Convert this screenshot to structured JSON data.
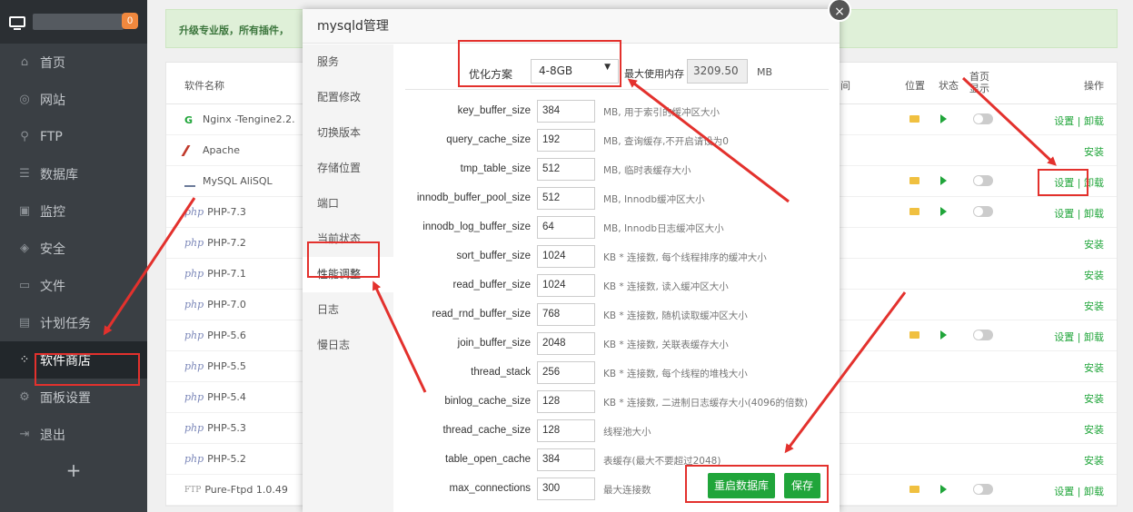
{
  "sidebar": {
    "badge": "0",
    "items": [
      {
        "icon": "home-icon",
        "glyph": "⌂",
        "label": "首页"
      },
      {
        "icon": "globe-icon",
        "glyph": "◎",
        "label": "网站"
      },
      {
        "icon": "ftp-icon",
        "glyph": "⚲",
        "label": "FTP"
      },
      {
        "icon": "database-icon",
        "glyph": "☰",
        "label": "数据库"
      },
      {
        "icon": "monitor-icon",
        "glyph": "▣",
        "label": "监控"
      },
      {
        "icon": "shield-icon",
        "glyph": "◈",
        "label": "安全"
      },
      {
        "icon": "folder-icon",
        "glyph": "▭",
        "label": "文件"
      },
      {
        "icon": "calendar-icon",
        "glyph": "▤",
        "label": "计划任务"
      },
      {
        "icon": "apps-icon",
        "glyph": "⁘",
        "label": "软件商店"
      },
      {
        "icon": "gear-icon",
        "glyph": "⚙",
        "label": "面板设置"
      },
      {
        "icon": "logout-icon",
        "glyph": "⇥",
        "label": "退出"
      }
    ],
    "add": "+"
  },
  "notice": "升级专业版，所有插件，",
  "table": {
    "headers": {
      "name": "软件名称",
      "col_time": "间",
      "location": "位置",
      "status": "状态",
      "home_show": "首页显示",
      "ops": "操作"
    },
    "rows": [
      {
        "name": "Nginx -Tengine2.2.",
        "prefix": "",
        "action": "设置 | 卸载",
        "installed": true
      },
      {
        "name": "Apache",
        "prefix": "",
        "action": "安装",
        "installed": false
      },
      {
        "name": "MySQL AliSQL",
        "prefix": "",
        "action": "设置 | 卸载",
        "installed": true
      },
      {
        "name": "PHP-7.3",
        "prefix": "php",
        "action": "设置 | 卸载",
        "installed": true
      },
      {
        "name": "PHP-7.2",
        "prefix": "php",
        "action": "安装",
        "installed": false
      },
      {
        "name": "PHP-7.1",
        "prefix": "php",
        "action": "安装",
        "installed": false
      },
      {
        "name": "PHP-7.0",
        "prefix": "php",
        "action": "安装",
        "installed": false
      },
      {
        "name": "PHP-5.6",
        "prefix": "php",
        "action": "设置 | 卸载",
        "installed": true
      },
      {
        "name": "PHP-5.5",
        "prefix": "php",
        "action": "安装",
        "installed": false
      },
      {
        "name": "PHP-5.4",
        "prefix": "php",
        "action": "安装",
        "installed": false
      },
      {
        "name": "PHP-5.3",
        "prefix": "php",
        "action": "安装",
        "installed": false
      },
      {
        "name": "PHP-5.2",
        "prefix": "php",
        "action": "安装",
        "installed": false
      },
      {
        "name": "Pure-Ftpd 1.0.49",
        "prefix": "FTP",
        "action": "设置 | 卸载",
        "installed": true
      }
    ]
  },
  "modal": {
    "title": "mysqld管理",
    "close": "×",
    "nav": [
      "服务",
      "配置修改",
      "切换版本",
      "存储位置",
      "端口",
      "当前状态",
      "性能调整",
      "日志",
      "慢日志"
    ],
    "opt_label": "优化方案",
    "opt_value": "4-8GB",
    "mem_label": "最大使用内存",
    "mem_value": "3209.50",
    "mem_unit": "MB",
    "params": [
      {
        "name": "key_buffer_size",
        "value": "384",
        "desc": "MB, 用于索引的缓冲区大小"
      },
      {
        "name": "query_cache_size",
        "value": "192",
        "desc": "MB, 查询缓存,不开启请设为0"
      },
      {
        "name": "tmp_table_size",
        "value": "512",
        "desc": "MB, 临时表缓存大小"
      },
      {
        "name": "innodb_buffer_pool_size",
        "value": "512",
        "desc": "MB, Innodb缓冲区大小"
      },
      {
        "name": "innodb_log_buffer_size",
        "value": "64",
        "desc": "MB, Innodb日志缓冲区大小"
      },
      {
        "name": "sort_buffer_size",
        "value": "1024",
        "desc": "KB * 连接数, 每个线程排序的缓冲大小"
      },
      {
        "name": "read_buffer_size",
        "value": "1024",
        "desc": "KB * 连接数, 读入缓冲区大小"
      },
      {
        "name": "read_rnd_buffer_size",
        "value": "768",
        "desc": "KB * 连接数, 随机读取缓冲区大小"
      },
      {
        "name": "join_buffer_size",
        "value": "2048",
        "desc": "KB * 连接数, 关联表缓存大小"
      },
      {
        "name": "thread_stack",
        "value": "256",
        "desc": "KB * 连接数, 每个线程的堆栈大小"
      },
      {
        "name": "binlog_cache_size",
        "value": "128",
        "desc": "KB * 连接数, 二进制日志缓存大小(4096的倍数)"
      },
      {
        "name": "thread_cache_size",
        "value": "128",
        "desc": "线程池大小"
      },
      {
        "name": "table_open_cache",
        "value": "384",
        "desc": "表缓存(最大不要超过2048)"
      },
      {
        "name": "max_connections",
        "value": "300",
        "desc": "最大连接数"
      }
    ],
    "restart_btn": "重启数据库",
    "save_btn": "保存"
  },
  "colors": {
    "accent": "#20a53a",
    "annotation": "#e3312d",
    "sidebar": "#3a3f44"
  }
}
